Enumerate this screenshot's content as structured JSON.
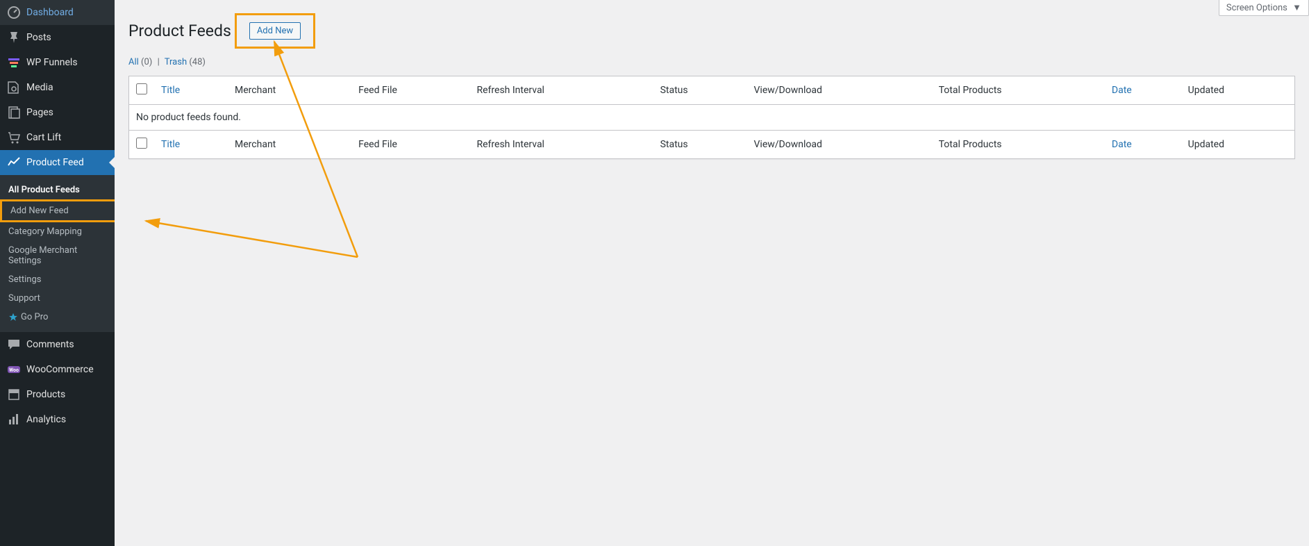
{
  "sidebar": {
    "top": [
      {
        "id": "dashboard",
        "label": "Dashboard",
        "icon": "dashboard"
      },
      {
        "id": "posts",
        "label": "Posts",
        "icon": "pin"
      },
      {
        "id": "wpfunnels",
        "label": "WP Funnels",
        "icon": "funnels"
      },
      {
        "id": "media",
        "label": "Media",
        "icon": "media"
      },
      {
        "id": "pages",
        "label": "Pages",
        "icon": "pages"
      },
      {
        "id": "cartlift",
        "label": "Cart Lift",
        "icon": "cart"
      },
      {
        "id": "productfeed",
        "label": "Product Feed",
        "icon": "chart",
        "active": true
      }
    ],
    "submenu": [
      {
        "label": "All Product Feeds",
        "current": true
      },
      {
        "label": "Add New Feed",
        "highlighted": true
      },
      {
        "label": "Category Mapping"
      },
      {
        "label": "Google Merchant Settings"
      },
      {
        "label": "Settings"
      },
      {
        "label": "Support"
      },
      {
        "label": "Go Pro",
        "star": true
      }
    ],
    "bottom": [
      {
        "id": "comments",
        "label": "Comments",
        "icon": "comment"
      },
      {
        "id": "woocommerce",
        "label": "WooCommerce",
        "icon": "woo"
      },
      {
        "id": "products",
        "label": "Products",
        "icon": "products"
      },
      {
        "id": "analytics",
        "label": "Analytics",
        "icon": "analytics"
      }
    ]
  },
  "page": {
    "title": "Product Feeds",
    "add_new": "Add New",
    "screen_options": "Screen Options"
  },
  "filters": {
    "all_label": "All",
    "all_count": "(0)",
    "trash_label": "Trash",
    "trash_count": "(48)"
  },
  "table": {
    "cols": {
      "title": "Title",
      "merchant": "Merchant",
      "feed_file": "Feed File",
      "refresh": "Refresh Interval",
      "status": "Status",
      "view": "View/Download",
      "total": "Total Products",
      "date": "Date",
      "updated": "Updated"
    },
    "empty": "No product feeds found."
  }
}
